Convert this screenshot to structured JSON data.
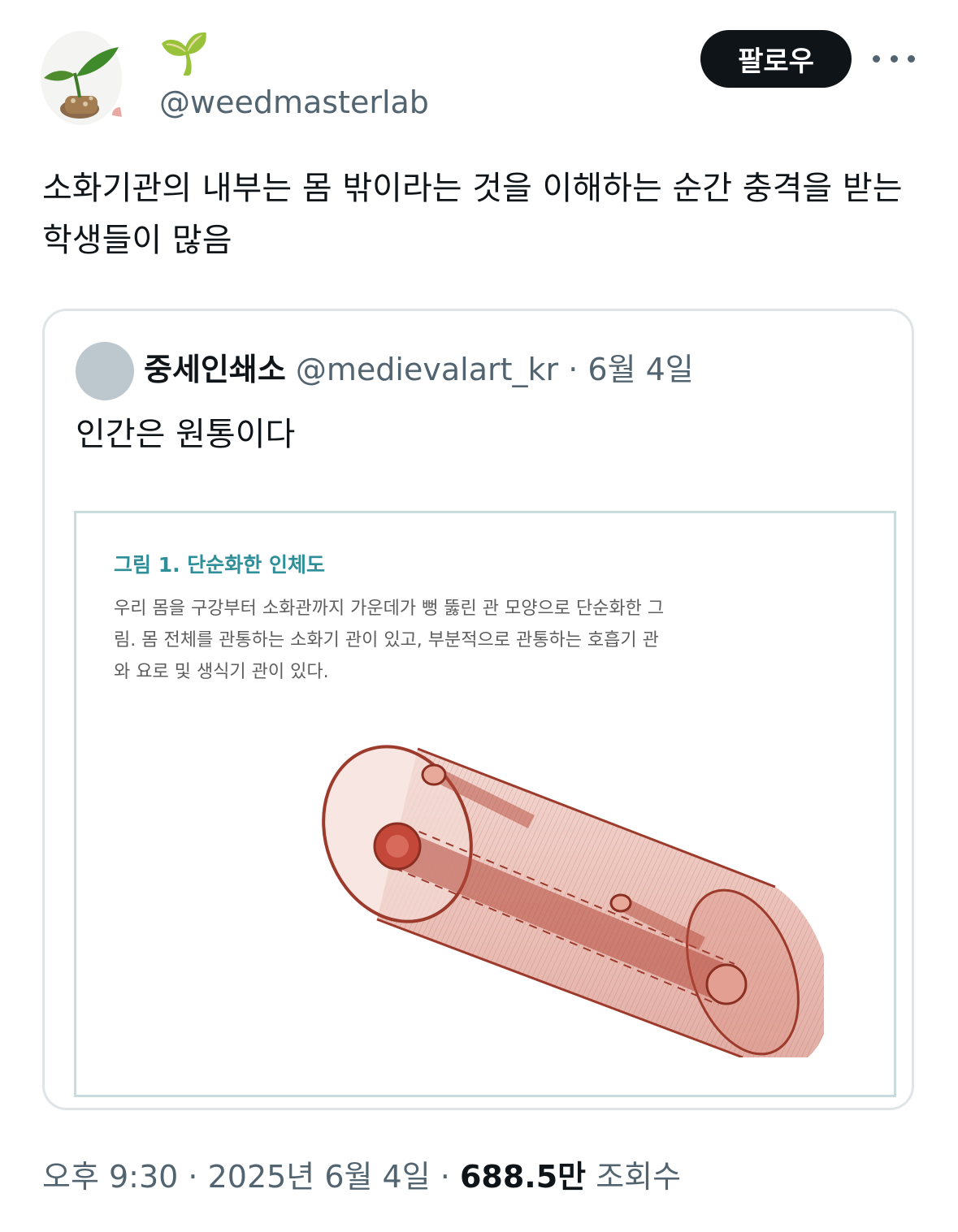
{
  "author": {
    "display_name": "🌱",
    "handle": "@weedmasterlab"
  },
  "actions": {
    "follow_label": "팔로우"
  },
  "tweet": {
    "text": "소화기관의 내부는 몸 밖이라는 것을 이해하는 순간 충격을 받는 학생들이 많음"
  },
  "quote": {
    "name": "중세인쇄소",
    "handle": "@medievalart_kr",
    "separator": " · ",
    "date": "6월 4일",
    "text": "인간은 원통이다",
    "figure": {
      "title": "그림 1. 단순화한 인체도",
      "caption": "우리 몸을 구강부터 소화관까지 가운데가 뻥 뚫린 관 모양으로 단순화한 그림. 몸 전체를 관통하는 소화기 관이 있고, 부분적으로 관통하는 호흡기 관와 요로 및 생식기 관이 있다."
    }
  },
  "footer": {
    "time": "오후 9:30",
    "separator": " · ",
    "date": "2025년 6월 4일",
    "views_count": "688.5만",
    "views_label": "조회수"
  },
  "colors": {
    "follow_bg": "#0f1419",
    "secondary_text": "#536471",
    "figure_title": "#2e8f99",
    "tube": "#b5493a"
  }
}
